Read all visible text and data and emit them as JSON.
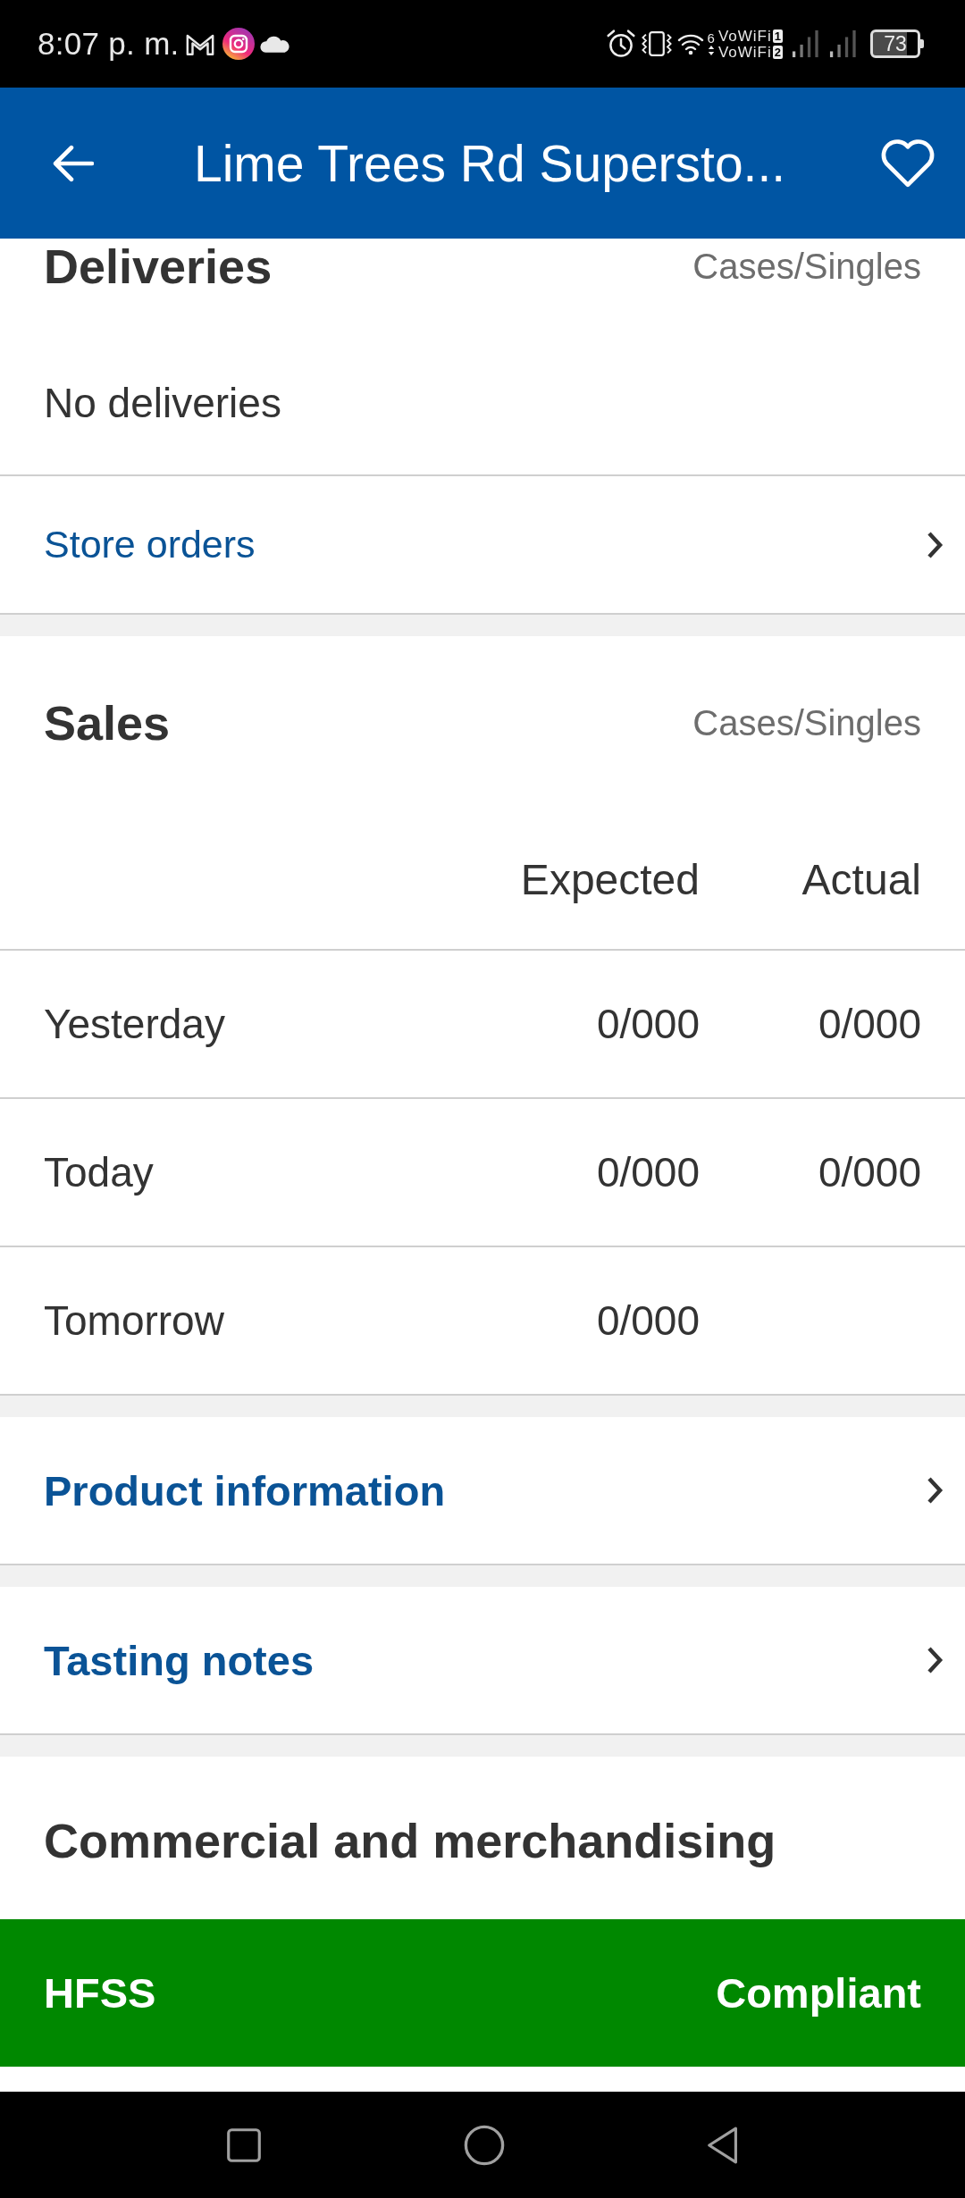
{
  "status_bar": {
    "time": "8:07 p. m.",
    "wifi_badge": "6",
    "sims": [
      {
        "label": "VoWiFi",
        "slot": "1"
      },
      {
        "label": "VoWiFi",
        "slot": "2"
      }
    ],
    "battery": "73"
  },
  "app_bar": {
    "title": "Lime Trees Rd Supersto...",
    "favorite": false
  },
  "deliveries": {
    "title": "Deliveries",
    "unit_label": "Cases/Singles",
    "message": "No deliveries",
    "link": "Store orders"
  },
  "sales": {
    "title": "Sales",
    "unit_label": "Cases/Singles",
    "columns": [
      "Expected",
      "Actual"
    ],
    "rows": [
      {
        "label": "Yesterday",
        "expected": "0/000",
        "actual": "0/000"
      },
      {
        "label": "Today",
        "expected": "0/000",
        "actual": "0/000"
      },
      {
        "label": "Tomorrow",
        "expected": "0/000"
      }
    ]
  },
  "links": [
    {
      "label": "Product information"
    },
    {
      "label": "Tasting notes"
    }
  ],
  "commercial": {
    "title": "Commercial and merchandising",
    "items": [
      {
        "label": "HFSS",
        "status": "Compliant",
        "color": "#008800"
      }
    ]
  }
}
